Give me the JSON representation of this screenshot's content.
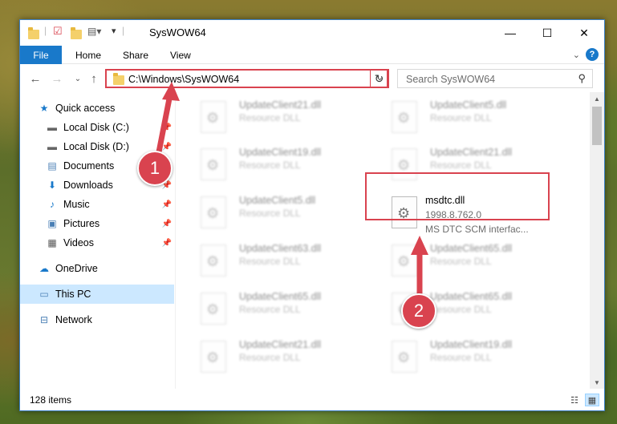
{
  "window": {
    "title": "SysWOW64",
    "controls": {
      "minimize": "—",
      "maximize": "☐",
      "close": "✕"
    }
  },
  "ribbon": {
    "tabs": [
      "File",
      "Home",
      "Share",
      "View"
    ],
    "help": "?"
  },
  "navbar": {
    "address": "C:\\Windows\\SysWOW64",
    "search_placeholder": "Search SysWOW64"
  },
  "sidebar": {
    "items": [
      {
        "label": "Quick access",
        "icon": "star-icon"
      },
      {
        "label": "Local Disk (C:)",
        "icon": "drive-icon"
      },
      {
        "label": "Local Disk (D:)",
        "icon": "drive-icon"
      },
      {
        "label": "Documents",
        "icon": "documents-icon"
      },
      {
        "label": "Downloads",
        "icon": "download-icon"
      },
      {
        "label": "Music",
        "icon": "music-icon"
      },
      {
        "label": "Pictures",
        "icon": "pictures-icon"
      },
      {
        "label": "Videos",
        "icon": "videos-icon"
      },
      {
        "label": "OneDrive",
        "icon": "cloud-icon"
      },
      {
        "label": "This PC",
        "icon": "computer-icon"
      },
      {
        "label": "Network",
        "icon": "network-icon"
      }
    ]
  },
  "files": {
    "col1": [
      {
        "name": "UpdateClient21.dll",
        "type": "Resource DLL"
      },
      {
        "name": "UpdateClient19.dll",
        "type": "Resource DLL"
      },
      {
        "name": "UpdateClient5.dll",
        "type": "Resource DLL"
      },
      {
        "name": "UpdateClient63.dll",
        "type": "Resource DLL"
      },
      {
        "name": "UpdateClient65.dll",
        "type": "Resource DLL"
      },
      {
        "name": "UpdateClient21.dll",
        "type": "Resource DLL"
      }
    ],
    "col2": [
      {
        "name": "UpdateClient5.dll",
        "type": "Resource DLL"
      },
      {
        "name": "UpdateClient21.dll",
        "type": "Resource DLL"
      },
      {
        "name": "msdtc.dll",
        "version": "1998.8.762.0",
        "type": "MS DTC SCM interfac..."
      },
      {
        "name": "UpdateClient65.dll",
        "type": "Resource DLL"
      },
      {
        "name": "UpdateClient65.dll",
        "type": "Resource DLL"
      },
      {
        "name": "UpdateClient19.dll",
        "type": "Resource DLL"
      }
    ]
  },
  "statusbar": {
    "count": "128 items"
  },
  "annotations": {
    "step1": "1",
    "step2": "2",
    "color": "#d9434f"
  }
}
